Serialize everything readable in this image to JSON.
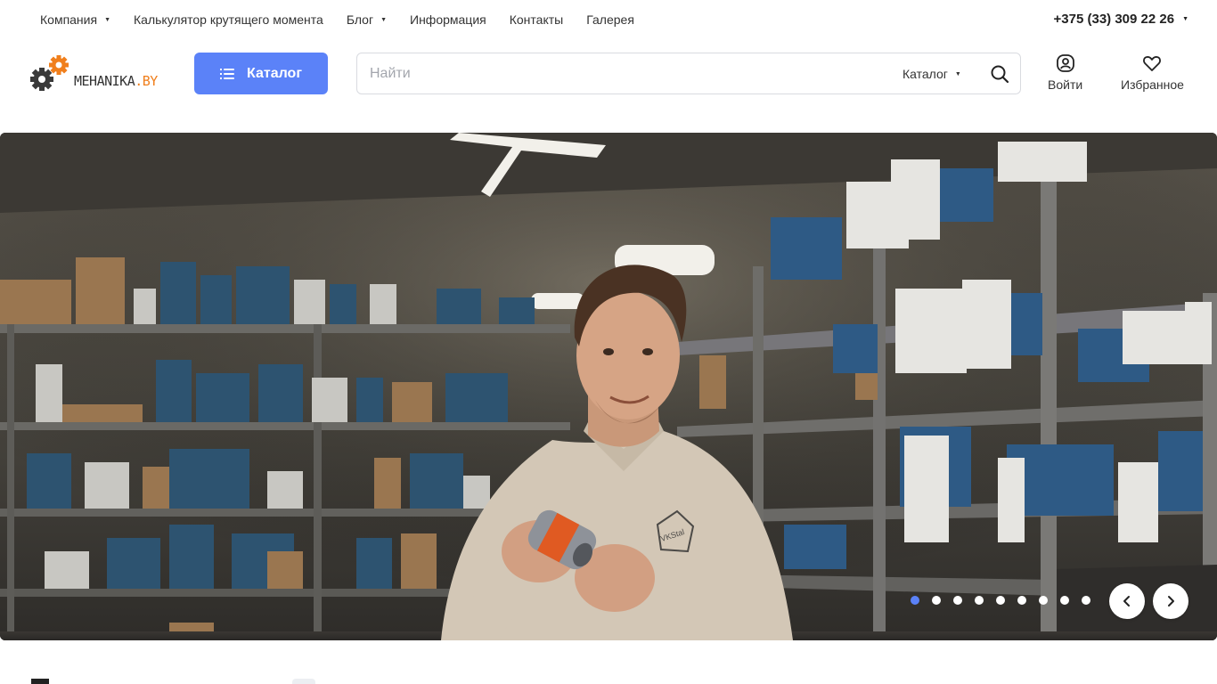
{
  "topnav": {
    "items": [
      {
        "label": "Компания",
        "dropdown": true
      },
      {
        "label": "Калькулятор крутящего момента",
        "dropdown": false
      },
      {
        "label": "Блог",
        "dropdown": true
      },
      {
        "label": "Информация",
        "dropdown": false
      },
      {
        "label": "Контакты",
        "dropdown": false
      },
      {
        "label": "Галерея",
        "dropdown": false
      }
    ],
    "phone": "+375 (33) 309 22 26"
  },
  "header": {
    "logo_text_main": "MEHANIKA",
    "logo_text_suffix": ".BY",
    "catalog_label": "Каталог",
    "search_placeholder": "Найти",
    "search_scope": "Каталог",
    "login_label": "Войти",
    "favorites_label": "Избранное"
  },
  "hero": {
    "shirt_logo_text": "VKStal",
    "slides_count": 9,
    "active_slide": 1
  },
  "colors": {
    "accent": "#5b82f8",
    "brand_orange": "#f07f1c",
    "logo_gray": "#333333"
  },
  "icons": [
    "gear-icon",
    "list-icon",
    "search-icon",
    "user-icon",
    "heart-icon",
    "chevron-left-icon",
    "chevron-right-icon",
    "caret-down-icon"
  ]
}
